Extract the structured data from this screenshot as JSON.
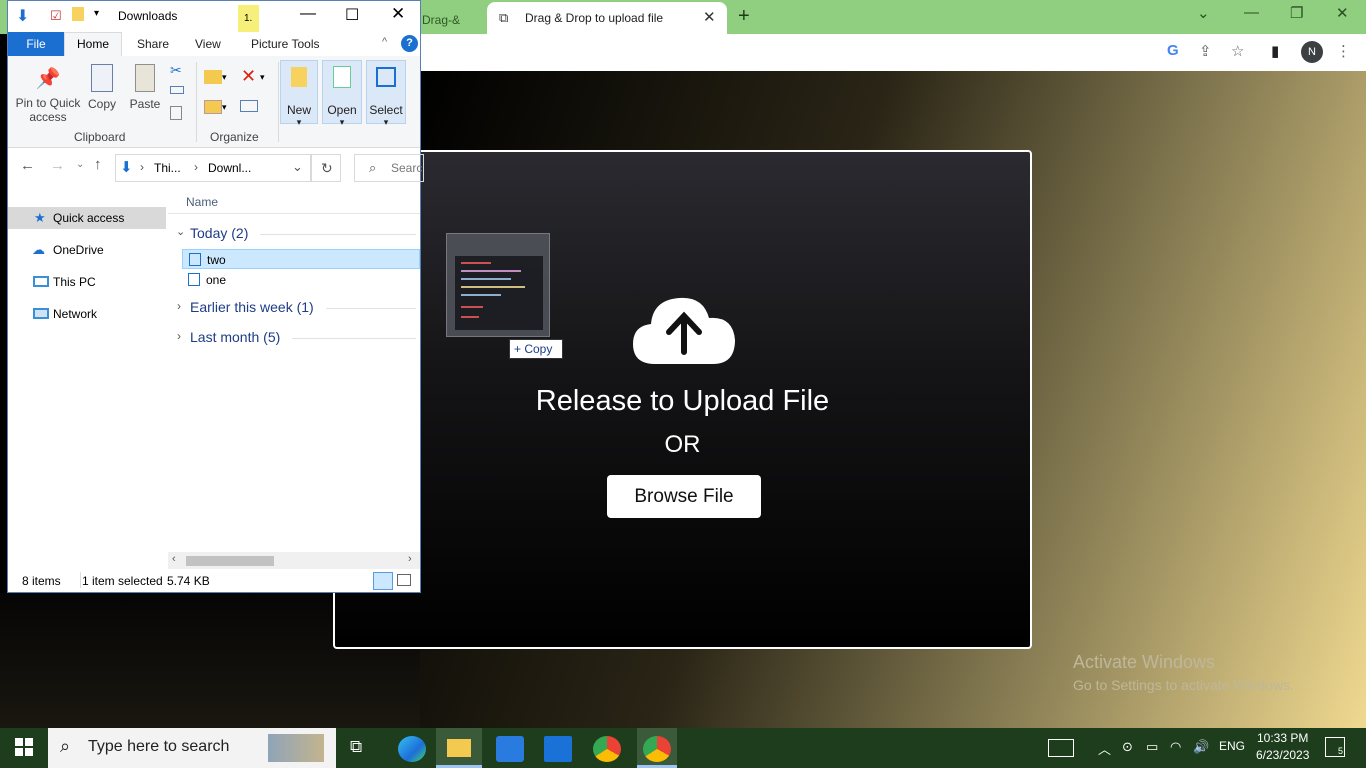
{
  "chrome": {
    "inactive_tab_label": "Drag-&",
    "active_tab_title": "Drag & Drop to upload file",
    "profile_initial": "N"
  },
  "page": {
    "dropzone_title": "Release to Upload File",
    "dropzone_or": "OR",
    "browse_button": "Browse File",
    "drag_effect_label": "Copy",
    "activate_line1": "Activate Windows",
    "activate_line2": "Go to Settings to activate Windows."
  },
  "explorer": {
    "window_title": "Downloads",
    "contextual_tab_badge": "1.",
    "ribbon_tabs": [
      "File",
      "Home",
      "Share",
      "View",
      "Picture Tools"
    ],
    "ribbon": {
      "pin_label_1": "Pin to Quick",
      "pin_label_2": "access",
      "copy_label": "Copy",
      "paste_label": "Paste",
      "clipboard_group": "Clipboard",
      "organize_group": "Organize",
      "new_label": "New",
      "open_label": "Open",
      "select_label": "Select"
    },
    "breadcrumb": [
      "Thi...",
      "Downl..."
    ],
    "search_placeholder": "Search",
    "nav_items": [
      "Quick access",
      "OneDrive",
      "This PC",
      "Network"
    ],
    "column_name": "Name",
    "groups": {
      "today": "Today (2)",
      "earlier": "Earlier this week (1)",
      "last_month": "Last month (5)"
    },
    "files": [
      "two",
      "one"
    ],
    "status": {
      "item_count": "8 items",
      "selection": "1 item selected",
      "size": "5.74 KB"
    }
  },
  "taskbar": {
    "search_placeholder": "Type here to search",
    "language": "ENG",
    "time": "10:33 PM",
    "date": "6/23/2023",
    "notification_count": "5"
  }
}
